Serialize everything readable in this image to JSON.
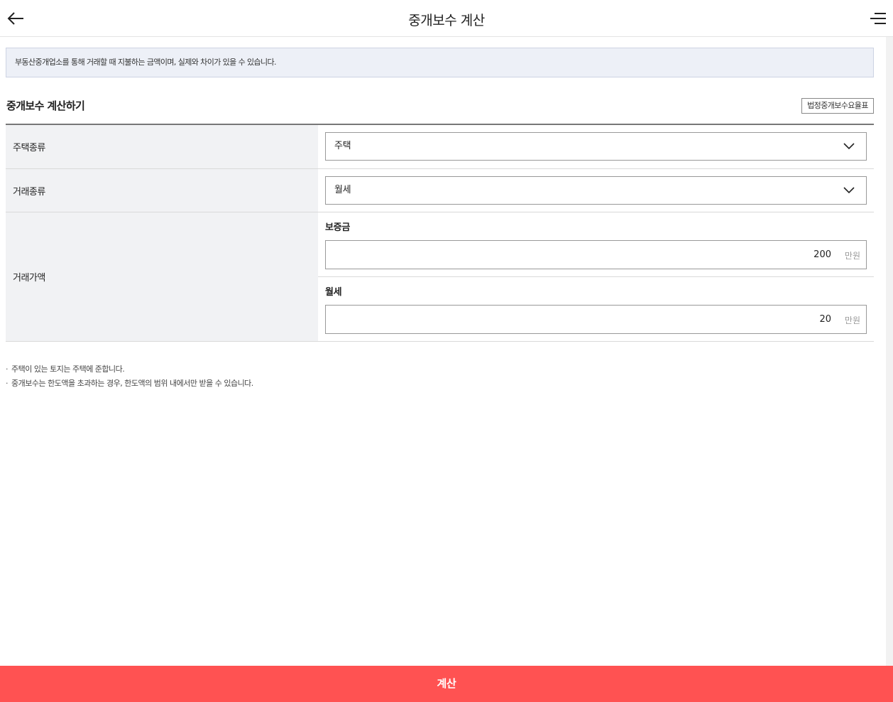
{
  "header": {
    "title": "중개보수 계산",
    "back_icon": "arrow-left-icon",
    "menu_icon": "menu-icon"
  },
  "notice": "부동산중개업소를 통해 거래할 때 지불하는 금액이며, 실제와 차이가 있을 수 있습니다.",
  "section": {
    "title": "중개보수 계산하기",
    "fee_table_button": "법정중개보수요율표"
  },
  "form": {
    "housing_type": {
      "label": "주택종류",
      "value": "주택"
    },
    "trade_type": {
      "label": "거래종류",
      "value": "월세"
    },
    "trade_amount": {
      "label": "거래가액",
      "deposit": {
        "label": "보증금",
        "value": "200",
        "unit": "만원"
      },
      "monthly_rent": {
        "label": "월세",
        "value": "20",
        "unit": "만원"
      }
    }
  },
  "notes": [
    "주택이 있는 토지는 주택에 준합니다.",
    "중개보수는 한도액을 초과하는 경우, 한도액의 범위 내에서만 받을 수 있습니다."
  ],
  "calc_button": "계산",
  "colors": {
    "accent": "#ff5252",
    "notice_bg": "#edf0f7",
    "label_bg": "#f1f2f4"
  }
}
